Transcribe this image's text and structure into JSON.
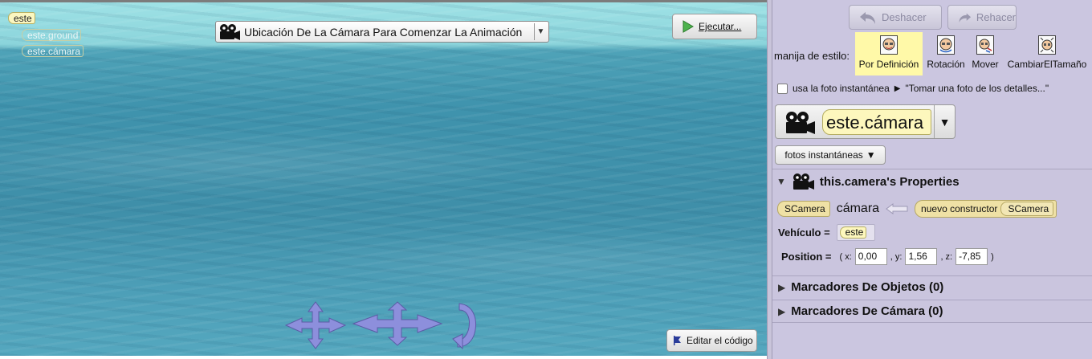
{
  "scene": {
    "tree": {
      "root": "este",
      "ground": "este.ground",
      "camera": "este.cámara"
    },
    "camera_marker_select": "Ubicación De La Cámara Para Comenzar La Animación",
    "run_button": "Ejecutar...",
    "edit_code_button": "Editar el código"
  },
  "history": {
    "undo": "Deshacer",
    "redo": "Rehacer"
  },
  "handles": {
    "label": "manija de estilo:",
    "items": [
      "Por Definición",
      "Rotación",
      "Mover",
      "CambiarElTamaño"
    ],
    "selected": "Por Definición"
  },
  "snapshot_option": {
    "checkbox_label": "usa la foto instantánea",
    "hint": "\"Tomar una foto de los detalles...\"",
    "checked": false
  },
  "selected_object": "este.cámara",
  "snapshots_button": "fotos instantáneas",
  "properties": {
    "header": "this.camera's Properties",
    "declaration": {
      "type": "SCamera",
      "name": "cámara",
      "constructor": "nuevo constructor",
      "constructor_type": "SCamera"
    },
    "vehicle": {
      "label": "Vehículo =",
      "value": "este"
    },
    "position": {
      "label": "Position =",
      "open": "( x:",
      "x": "0,00",
      "y_label": ", y:",
      "y": "1,56",
      "z_label": ", z:",
      "z": "-7,85",
      "close": ")"
    }
  },
  "sections": {
    "object_markers": "Marcadores De Objetos (0)",
    "camera_markers": "Marcadores De Cámara (0)"
  },
  "colors": {
    "sky": "#9fe2e6",
    "water": "#3f8fa9",
    "panel": "#cbc6e0",
    "pill": "#fdf7bd",
    "highlight": "#fff9a8"
  }
}
